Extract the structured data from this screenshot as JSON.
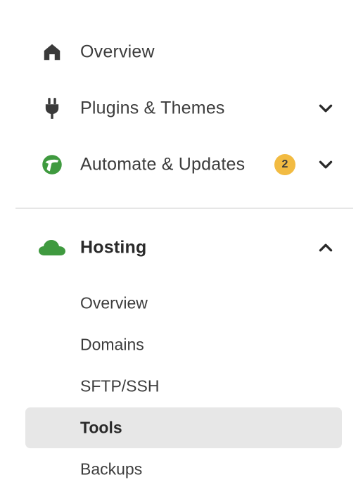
{
  "nav": {
    "items": [
      {
        "label": "Overview",
        "icon": "home-icon"
      },
      {
        "label": "Plugins & Themes",
        "icon": "plug-icon",
        "expanded": false
      },
      {
        "label": "Automate & Updates",
        "icon": "automate-icon",
        "badge": "2",
        "expanded": false
      }
    ],
    "hosting": {
      "label": "Hosting",
      "icon": "cloud-icon",
      "expanded": true,
      "sub_items": [
        {
          "label": "Overview",
          "active": false
        },
        {
          "label": "Domains",
          "active": false
        },
        {
          "label": "SFTP/SSH",
          "active": false
        },
        {
          "label": "Tools",
          "active": true
        },
        {
          "label": "Backups",
          "active": false
        }
      ]
    }
  },
  "colors": {
    "accent_green": "#3f9a3f",
    "badge_yellow": "#f2bb42",
    "active_bg": "#e7e7e7",
    "icon_gray": "#3a3a3a"
  }
}
